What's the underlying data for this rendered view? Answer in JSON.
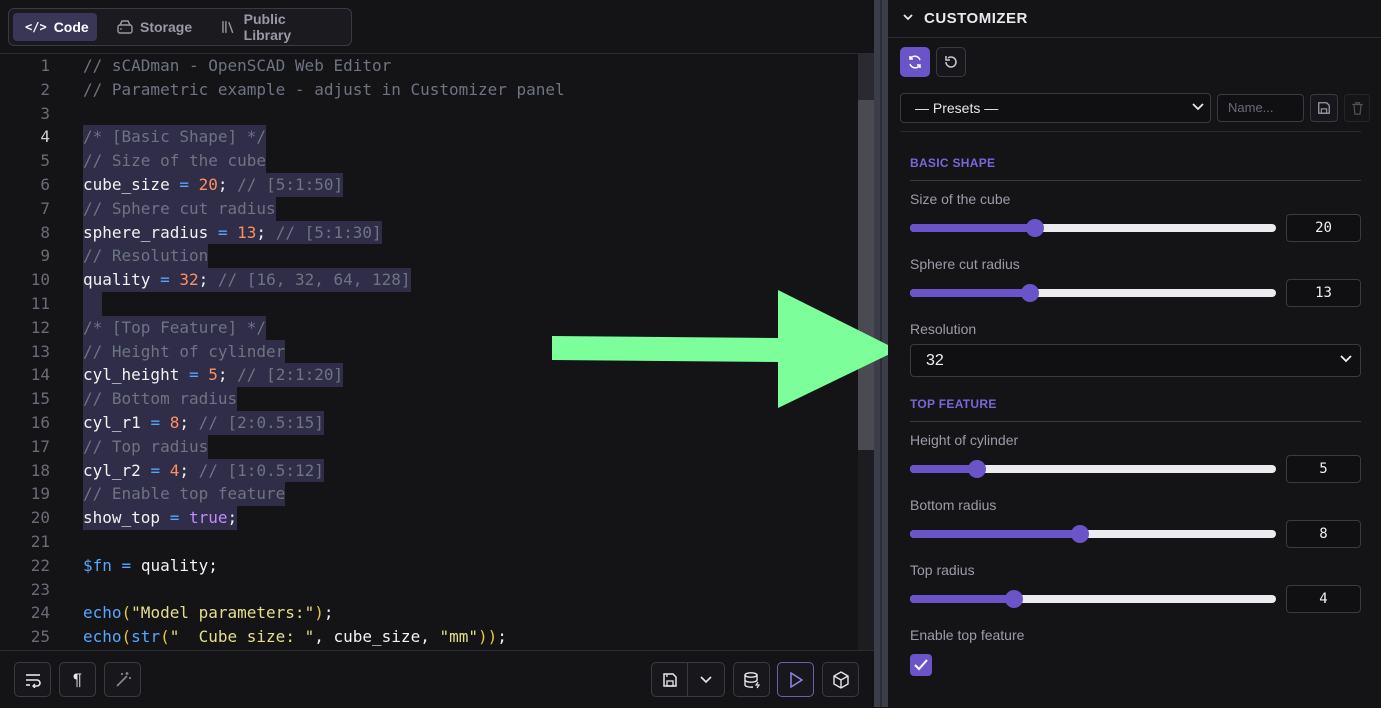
{
  "editor": {
    "tabs": [
      {
        "label": "Code",
        "icon": "code-icon",
        "active": true
      },
      {
        "label": "Storage",
        "icon": "drive-icon",
        "active": false
      },
      {
        "label": "Public Library",
        "icon": "library-icon",
        "active": false
      }
    ],
    "current_line": "4",
    "lines": [
      {
        "n": "1",
        "t": "// sCADman - OpenSCAD Web Editor"
      },
      {
        "n": "2",
        "t": "// Parametric example - adjust in Customizer panel"
      },
      {
        "n": "3",
        "t": ""
      },
      {
        "n": "4",
        "t": "/* [Basic Shape] */"
      },
      {
        "n": "5",
        "t": "// Size of the cube"
      },
      {
        "n": "6",
        "t": "cube_size = 20; // [5:1:50]"
      },
      {
        "n": "7",
        "t": "// Sphere cut radius"
      },
      {
        "n": "8",
        "t": "sphere_radius = 13; // [5:1:30]"
      },
      {
        "n": "9",
        "t": "// Resolution"
      },
      {
        "n": "10",
        "t": "quality = 32; // [16, 32, 64, 128]"
      },
      {
        "n": "11",
        "t": ""
      },
      {
        "n": "12",
        "t": "/* [Top Feature] */"
      },
      {
        "n": "13",
        "t": "// Height of cylinder"
      },
      {
        "n": "14",
        "t": "cyl_height = 5; // [2:1:20]"
      },
      {
        "n": "15",
        "t": "// Bottom radius"
      },
      {
        "n": "16",
        "t": "cyl_r1 = 8; // [2:0.5:15]"
      },
      {
        "n": "17",
        "t": "// Top radius"
      },
      {
        "n": "18",
        "t": "cyl_r2 = 4; // [1:0.5:12]"
      },
      {
        "n": "19",
        "t": "// Enable top feature"
      },
      {
        "n": "20",
        "t": "show_top = true;"
      },
      {
        "n": "21",
        "t": ""
      },
      {
        "n": "22",
        "t": "$fn = quality;"
      },
      {
        "n": "23",
        "t": ""
      },
      {
        "n": "24",
        "t": "echo(\"Model parameters:\");"
      },
      {
        "n": "25",
        "t": "echo(str(\"  Cube size: \", cube_size, \"mm\"));"
      }
    ],
    "bottom_buttons": [
      {
        "name": "word-wrap-button",
        "icon": "wrap-icon"
      },
      {
        "name": "show-whitespace-button",
        "icon": "pilcrow-icon"
      },
      {
        "name": "format-button",
        "icon": "magic-wand-icon"
      },
      {
        "name": "save-button",
        "icon": "save-icon"
      },
      {
        "name": "save-options-button",
        "icon": "chevron-down-icon"
      },
      {
        "name": "database-button",
        "icon": "database-icon"
      },
      {
        "name": "run-button",
        "icon": "play-icon"
      },
      {
        "name": "render-3d-button",
        "icon": "cube-icon"
      }
    ]
  },
  "customizer": {
    "title": "CUSTOMIZER",
    "presets_label": "— Presets —",
    "name_placeholder": "Name...",
    "sections": [
      {
        "title": "BASIC SHAPE",
        "params": [
          {
            "label": "Size of the cube",
            "type": "slider",
            "value": "20",
            "min": 5,
            "max": 50
          },
          {
            "label": "Sphere cut radius",
            "type": "slider",
            "value": "13",
            "min": 5,
            "max": 30
          },
          {
            "label": "Resolution",
            "type": "select",
            "value": "32"
          }
        ]
      },
      {
        "title": "TOP FEATURE",
        "params": [
          {
            "label": "Height of cylinder",
            "type": "slider",
            "value": "5",
            "min": 2,
            "max": 20
          },
          {
            "label": "Bottom radius",
            "type": "slider",
            "value": "8",
            "min": 2,
            "max": 15
          },
          {
            "label": "Top radius",
            "type": "slider",
            "value": "4",
            "min": 1,
            "max": 12
          },
          {
            "label": "Enable top feature",
            "type": "checkbox",
            "checked": true
          }
        ]
      }
    ]
  },
  "colors": {
    "accent": "#6a54c8",
    "arrow": "#7cff9a",
    "background": "#141417"
  }
}
